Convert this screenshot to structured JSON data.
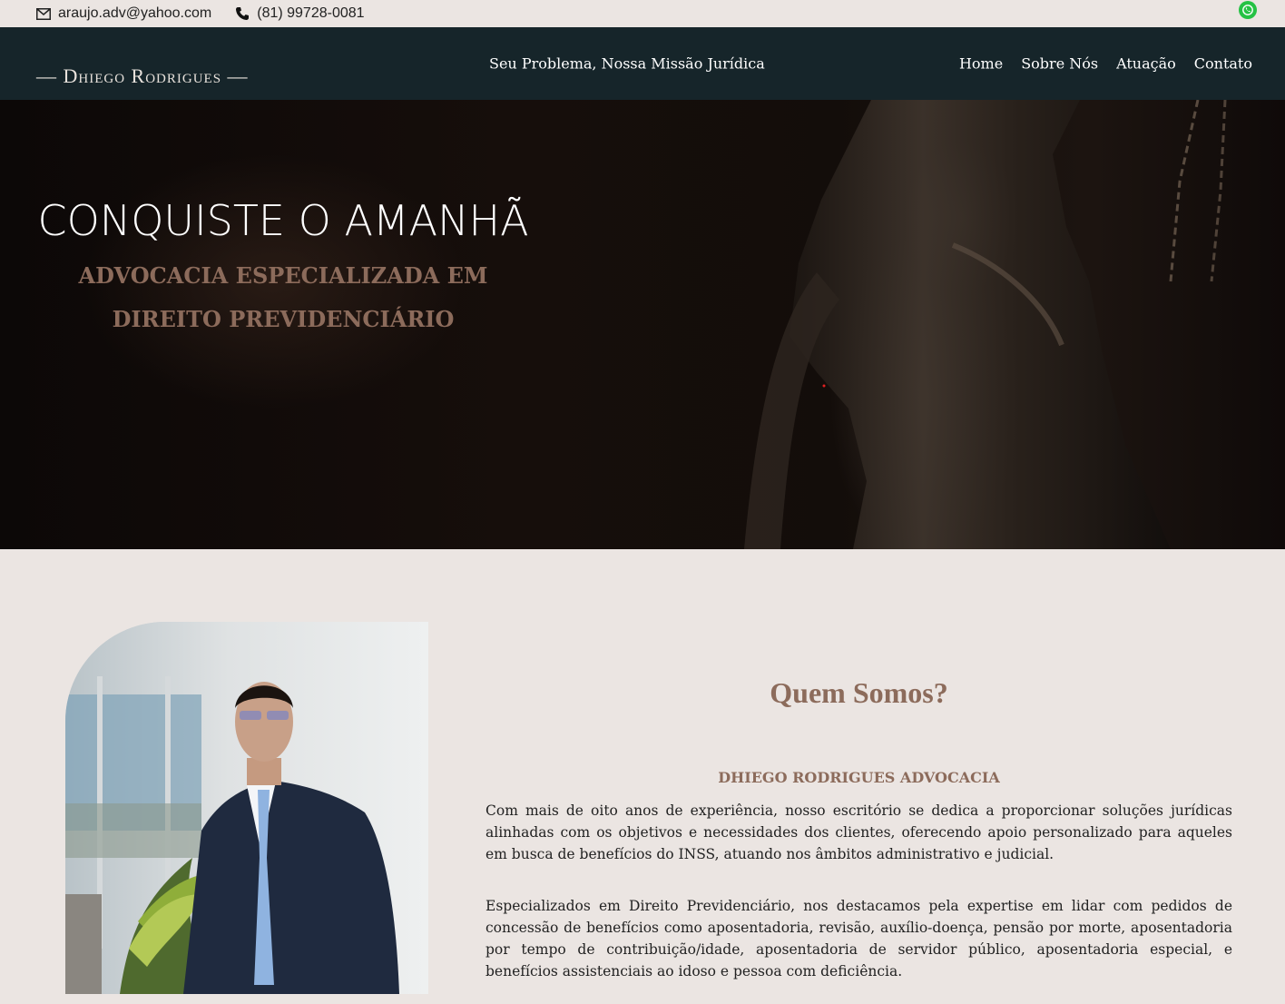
{
  "topbar": {
    "email": "araujo.adv@yahoo.com",
    "phone": "(81) 99728-0081",
    "icons": {
      "email": "envelope-icon",
      "phone": "phone-icon",
      "whatsapp": "whatsapp-icon"
    }
  },
  "nav": {
    "logo": "— Dhiego Rodrigues —",
    "tagline": "Seu Problema, Nossa Missão Jurídica",
    "items": [
      "Home",
      "Sobre Nós",
      "Atuação",
      "Contato"
    ]
  },
  "hero": {
    "title": "CONQUISTE O AMANHÃ",
    "subtitle": "ADVOCACIA ESPECIALIZADA EM DIREITO PREVIDENCIÁRIO"
  },
  "about": {
    "heading": "Quem Somos?",
    "subheading": "DHIEGO RODRIGUES ADVOCACIA",
    "paragraph1": "Com mais de oito anos de experiência, nosso escritório se dedica a proporcionar soluções jurídicas alinhadas com os objetivos e necessidades dos clientes, oferecendo apoio personalizado para aqueles em busca de benefícios do INSS, atuando nos âmbitos administrativo e judicial.",
    "paragraph2": "Especializados em Direito Previdenciário, nos destacamos pela expertise em lidar com pedidos de concessão de benefícios como aposentadoria, revisão, auxílio-doença, pensão por morte, aposentadoria por tempo de contribuição/idade, aposentadoria de servidor público, aposentadoria especial, e benefícios assistenciais ao idoso e pessoa com deficiência."
  },
  "colors": {
    "accent": "#8c6b5b",
    "nav_bg": "#16252a",
    "page_bg": "#ebe5e2",
    "whatsapp": "#25c244"
  }
}
